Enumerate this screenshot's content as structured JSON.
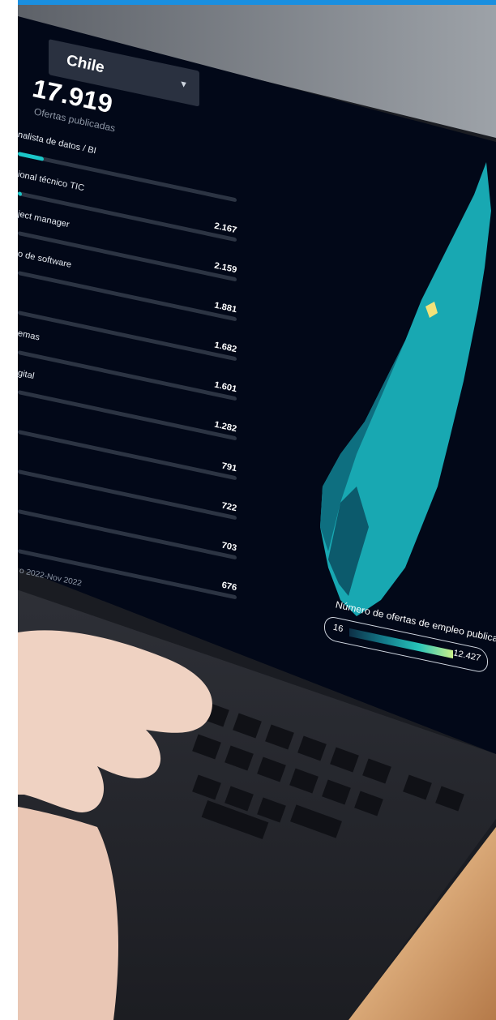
{
  "dashboard": {
    "country": "Chile",
    "total_offers": "17.919",
    "total_offers_label": "Ofertas publicadas",
    "job_rows": [
      {
        "name": "nalista de datos / BI",
        "value": "",
        "fill": 0.12
      },
      {
        "name": "ional técnico TIC",
        "value": "2.167",
        "fill": 0.02
      },
      {
        "name": "ject manager",
        "value": "2.159",
        "fill": 0
      },
      {
        "name": "o de software",
        "value": "1.881",
        "fill": 0
      },
      {
        "name": "",
        "value": "1.682",
        "fill": 0
      },
      {
        "name": "emas",
        "value": "1.601",
        "fill": 0
      },
      {
        "name": "gital",
        "value": "1.282",
        "fill": 0
      },
      {
        "name": "",
        "value": "791",
        "fill": 0
      },
      {
        "name": "",
        "value": "722",
        "fill": 0
      },
      {
        "name": "",
        "value": "703",
        "fill": 0
      },
      {
        "name": "",
        "value": "676",
        "fill": 0
      }
    ],
    "date_range": "o 2022-Nov 2022"
  },
  "legend": {
    "title": "Número de ofertas de empleo publicadas",
    "min": "16",
    "max": "12.427"
  },
  "colors": {
    "screen_bg": "#020818",
    "bar_fill": "#1bc6c8",
    "highlight_region": "#f2e27a",
    "top_accent": "#1a8fe0"
  }
}
